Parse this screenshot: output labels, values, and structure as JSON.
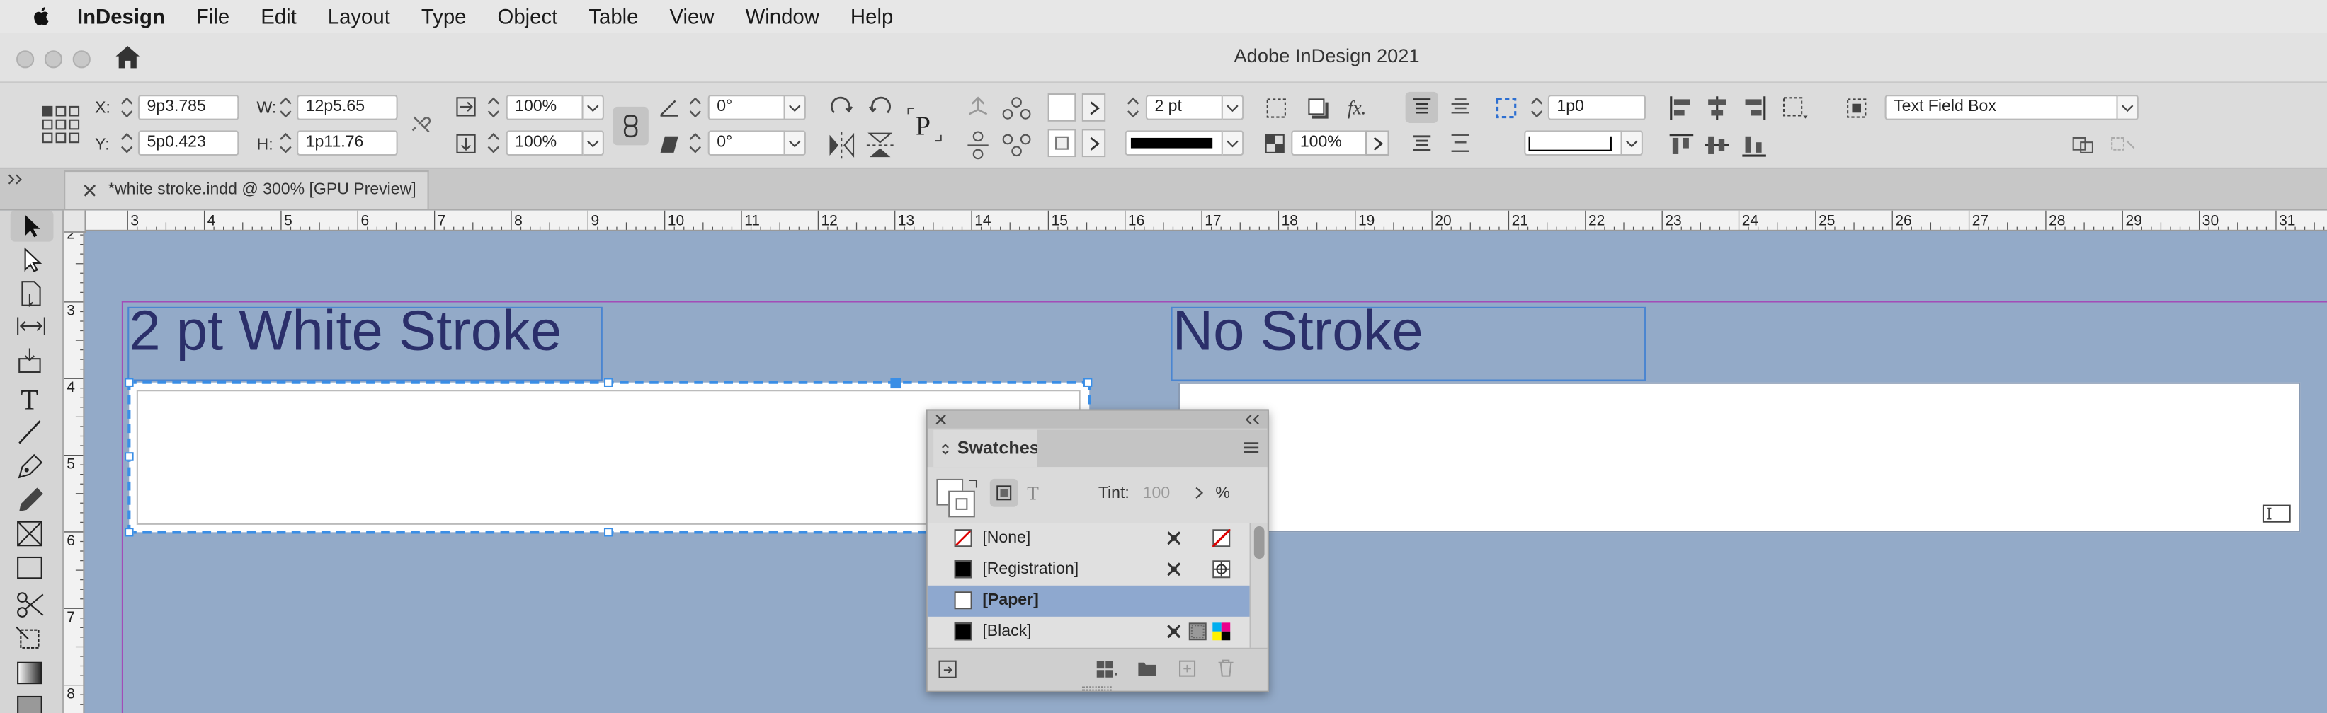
{
  "menubar": {
    "app_name": "InDesign",
    "items": [
      "File",
      "Edit",
      "Layout",
      "Type",
      "Object",
      "Table",
      "View",
      "Window",
      "Help"
    ]
  },
  "window": {
    "title": "Adobe InDesign 2021"
  },
  "control_panel": {
    "x_label": "X:",
    "x_value": "9p3.785",
    "y_label": "Y:",
    "y_value": "5p0.423",
    "w_label": "W:",
    "w_value": "12p5.65",
    "h_label": "H:",
    "h_value": "1p11.76",
    "scale_x": "100%",
    "scale_y": "100%",
    "rotate": "0°",
    "shear": "0°",
    "stroke_weight": "2 pt",
    "opacity": "100%",
    "inset": "1p0",
    "object_style": "Text Field Box"
  },
  "document_tab": {
    "label": "*white stroke.indd @ 300% [GPU Preview]"
  },
  "ruler": {
    "horizontal": [
      "3",
      "4",
      "5",
      "6",
      "7",
      "8",
      "9",
      "10",
      "11",
      "12",
      "13",
      "14",
      "15",
      "16",
      "17",
      "18",
      "19",
      "20",
      "21",
      "22",
      "23",
      "24",
      "25",
      "26",
      "27",
      "28",
      "29",
      "30",
      "31"
    ],
    "vertical": [
      "2",
      "3",
      "4",
      "5",
      "6",
      "7",
      "8"
    ]
  },
  "canvas": {
    "heading_left": "2 pt White Stroke",
    "heading_right": "No Stroke"
  },
  "swatches": {
    "title": "Swatches",
    "tint_label": "Tint:",
    "tint_value": "100",
    "percent": "%",
    "items": [
      {
        "name": "[None]"
      },
      {
        "name": "[Registration]"
      },
      {
        "name": "[Paper]"
      },
      {
        "name": "[Black]"
      }
    ]
  },
  "colors": {
    "canvas_bg": "#93aac8",
    "heading_text": "#2b2f6a",
    "selection": "#3a8ee6",
    "page_edge": "#a24db7",
    "selected_swatch_row": "#8ea8cf"
  }
}
